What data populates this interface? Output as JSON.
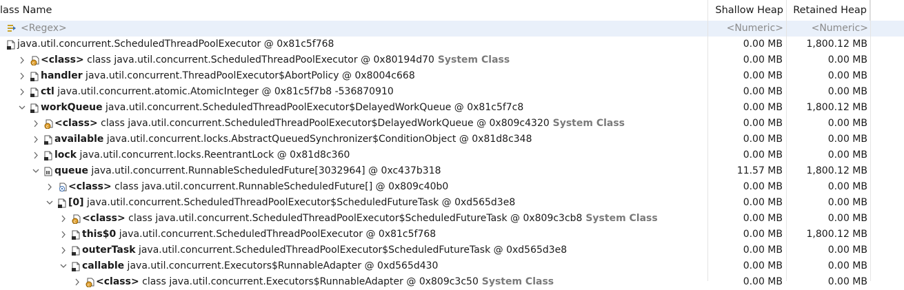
{
  "columns": {
    "name": "lass Name",
    "shallow": "Shallow Heap",
    "retained": "Retained Heap"
  },
  "filter": {
    "name": "<Regex>",
    "shallow": "<Numeric>",
    "retained": "<Numeric>"
  },
  "rows": [
    {
      "indent": 0,
      "twisty": "",
      "icon": "object",
      "field": "",
      "text": "java.util.concurrent.ScheduledThreadPoolExecutor @ 0x81c5f768",
      "extra": "",
      "sh": "0.00 MB",
      "ret": "1,800.12 MB"
    },
    {
      "indent": 1,
      "twisty": ">",
      "icon": "class",
      "field": "<class>",
      "text": " class java.util.concurrent.ScheduledThreadPoolExecutor @ 0x80194d70",
      "extra": "System Class",
      "sh": "0.00 MB",
      "ret": "0.00 MB"
    },
    {
      "indent": 1,
      "twisty": ">",
      "icon": "object",
      "field": "handler",
      "text": " java.util.concurrent.ThreadPoolExecutor$AbortPolicy @ 0x8004c668",
      "extra": "",
      "sh": "0.00 MB",
      "ret": "0.00 MB"
    },
    {
      "indent": 1,
      "twisty": ">",
      "icon": "object",
      "field": "ctl",
      "text": " java.util.concurrent.atomic.AtomicInteger @ 0x81c5f7b8  -536870910",
      "extra": "",
      "sh": "0.00 MB",
      "ret": "0.00 MB"
    },
    {
      "indent": 1,
      "twisty": "v",
      "icon": "object",
      "field": "workQueue",
      "text": " java.util.concurrent.ScheduledThreadPoolExecutor$DelayedWorkQueue @ 0x81c5f7c8",
      "extra": "",
      "sh": "0.00 MB",
      "ret": "1,800.12 MB"
    },
    {
      "indent": 2,
      "twisty": ">",
      "icon": "class",
      "field": "<class>",
      "text": " class java.util.concurrent.ScheduledThreadPoolExecutor$DelayedWorkQueue @ 0x809c4320",
      "extra": "System Class",
      "sh": "0.00 MB",
      "ret": "0.00 MB"
    },
    {
      "indent": 2,
      "twisty": ">",
      "icon": "object",
      "field": "available",
      "text": " java.util.concurrent.locks.AbstractQueuedSynchronizer$ConditionObject @ 0x81d8c348",
      "extra": "",
      "sh": "0.00 MB",
      "ret": "0.00 MB"
    },
    {
      "indent": 2,
      "twisty": ">",
      "icon": "object",
      "field": "lock",
      "text": " java.util.concurrent.locks.ReentrantLock @ 0x81d8c360",
      "extra": "",
      "sh": "0.00 MB",
      "ret": "0.00 MB"
    },
    {
      "indent": 2,
      "twisty": "v",
      "icon": "array",
      "field": "queue",
      "text": " java.util.concurrent.RunnableScheduledFuture[3032964] @ 0xc437b318",
      "extra": "",
      "sh": "11.57 MB",
      "ret": "1,800.12 MB"
    },
    {
      "indent": 3,
      "twisty": ">",
      "icon": "classarr",
      "field": "<class>",
      "text": " class java.util.concurrent.RunnableScheduledFuture[] @ 0x809c40b0",
      "extra": "",
      "sh": "0.00 MB",
      "ret": "0.00 MB"
    },
    {
      "indent": 3,
      "twisty": "v",
      "icon": "object",
      "field": "[0]",
      "text": " java.util.concurrent.ScheduledThreadPoolExecutor$ScheduledFutureTask @ 0xd565d3e8",
      "extra": "",
      "sh": "0.00 MB",
      "ret": "0.00 MB"
    },
    {
      "indent": 4,
      "twisty": ">",
      "icon": "class",
      "field": "<class>",
      "text": " class java.util.concurrent.ScheduledThreadPoolExecutor$ScheduledFutureTask @ 0x809c3cb8",
      "extra": "System Class",
      "sh": "0.00 MB",
      "ret": "0.00 MB"
    },
    {
      "indent": 4,
      "twisty": ">",
      "icon": "object",
      "field": "this$0",
      "text": " java.util.concurrent.ScheduledThreadPoolExecutor @ 0x81c5f768",
      "extra": "",
      "sh": "0.00 MB",
      "ret": "1,800.12 MB"
    },
    {
      "indent": 4,
      "twisty": ">",
      "icon": "object",
      "field": "outerTask",
      "text": " java.util.concurrent.ScheduledThreadPoolExecutor$ScheduledFutureTask @ 0xd565d3e8",
      "extra": "",
      "sh": "0.00 MB",
      "ret": "0.00 MB"
    },
    {
      "indent": 4,
      "twisty": "v",
      "icon": "object",
      "field": "callable",
      "text": " java.util.concurrent.Executors$RunnableAdapter @ 0xd565d430",
      "extra": "",
      "sh": "0.00 MB",
      "ret": "0.00 MB"
    },
    {
      "indent": 5,
      "twisty": ">",
      "icon": "class",
      "field": "<class>",
      "text": " class java.util.concurrent.Executors$RunnableAdapter @ 0x809c3c50",
      "extra": "System Class",
      "sh": "0.00 MB",
      "ret": "0.00 MB"
    }
  ]
}
